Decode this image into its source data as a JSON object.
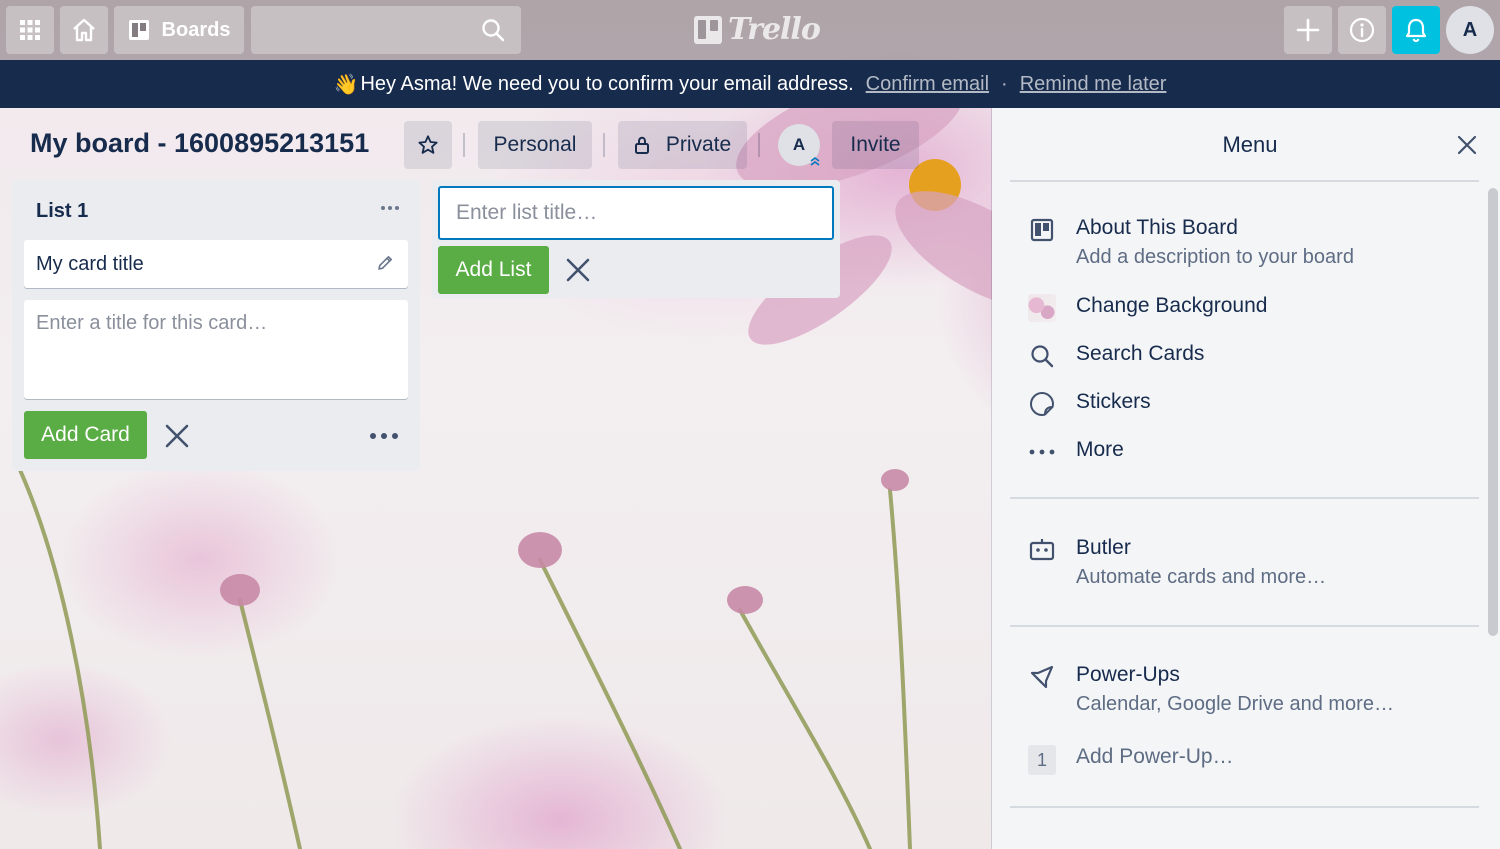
{
  "topbar": {
    "boards_label": "Boards",
    "search_placeholder": "",
    "logo_text": "Trello",
    "avatar_initial": "A"
  },
  "banner": {
    "emoji": "👋",
    "message": "Hey Asma! We need you to confirm your email address.",
    "confirm_link": "Confirm email",
    "separator": "·",
    "remind_link": "Remind me later"
  },
  "board": {
    "title": "My board - 1600895213151",
    "team_label": "Personal",
    "visibility_label": "Private",
    "member_initial": "A",
    "invite_label": "Invite"
  },
  "lists": [
    {
      "title": "List 1",
      "cards": [
        {
          "title": "My card title"
        }
      ],
      "composer_placeholder": "Enter a title for this card…",
      "add_card_label": "Add Card"
    }
  ],
  "add_list": {
    "placeholder": "Enter list title…",
    "button_label": "Add List"
  },
  "menu": {
    "title": "Menu",
    "items": [
      {
        "icon": "board-icon",
        "label": "About This Board",
        "description": "Add a description to your board"
      },
      {
        "icon": "background-thumbnail",
        "label": "Change Background"
      },
      {
        "icon": "search-icon",
        "label": "Search Cards"
      },
      {
        "icon": "sticker-icon",
        "label": "Stickers"
      },
      {
        "icon": "more-icon",
        "label": "More"
      },
      {
        "icon": "butler-icon",
        "label": "Butler",
        "description": "Automate cards and more…"
      },
      {
        "icon": "rocket-icon",
        "label": "Power-Ups",
        "description": "Calendar, Google Drive and more…"
      },
      {
        "icon": "count-badge",
        "badge": "1",
        "label": "Add Power-Up…"
      }
    ]
  },
  "colors": {
    "banner_bg": "#172b4d",
    "notification_accent": "#00c2e0",
    "green_button": "#5aac44",
    "focus_border": "#0079bf"
  }
}
